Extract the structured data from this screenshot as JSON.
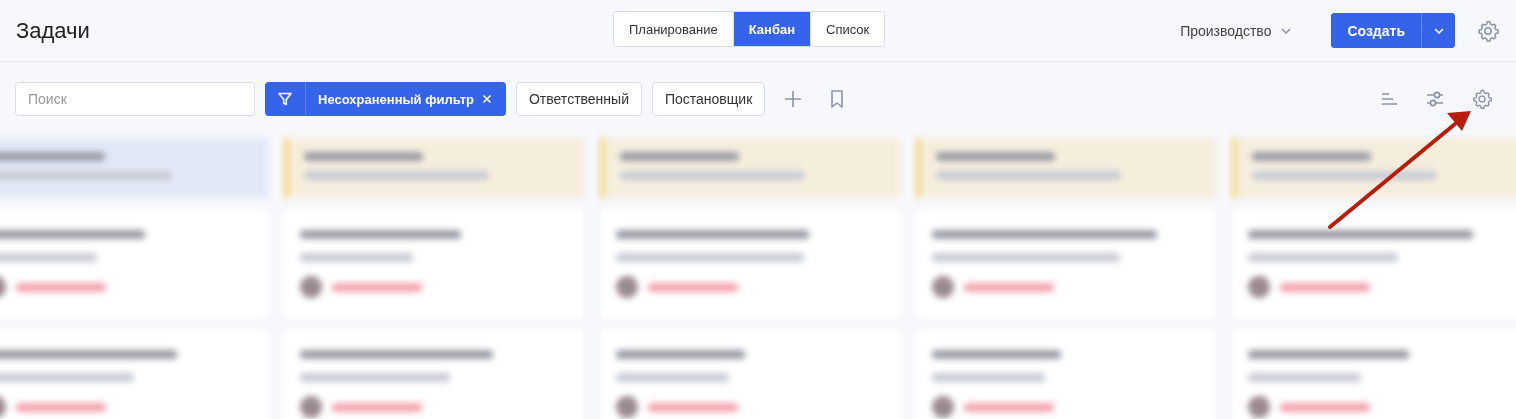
{
  "page_title": "Задачи",
  "view_tabs": [
    {
      "label": "Планирование",
      "selected": false
    },
    {
      "label": "Канбан",
      "selected": true
    },
    {
      "label": "Список",
      "selected": false
    }
  ],
  "project_selector": {
    "label": "Производство"
  },
  "create_button": {
    "label": "Создать"
  },
  "search": {
    "placeholder": "Поиск"
  },
  "active_filter": {
    "label": "Несохраненный фильтр"
  },
  "filter_buttons": [
    "Ответственный",
    "Постановщик"
  ]
}
